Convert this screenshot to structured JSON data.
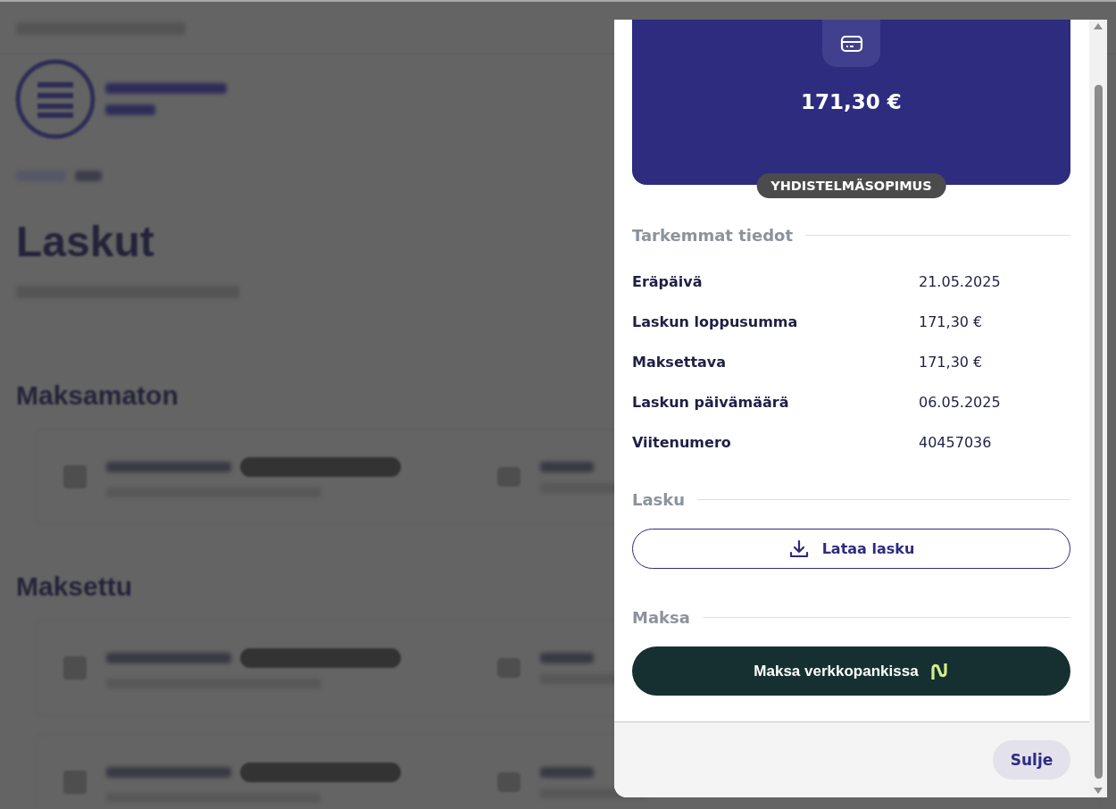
{
  "background_page": {
    "title": "Laskut",
    "sections": [
      {
        "title": "Maksamaton",
        "cards": [
          {
            "kind": "invoice"
          }
        ]
      },
      {
        "title": "Maksettu",
        "cards": [
          {
            "kind": "invoice"
          },
          {
            "kind": "invoice"
          }
        ]
      }
    ]
  },
  "dialog": {
    "amount": "171,30 €",
    "contract_badge": "YHDISTELMÄSOPIMUS",
    "sections": [
      {
        "kind": "details",
        "title": "Tarkemmat tiedot",
        "rows": [
          {
            "label": "Eräpäivä",
            "value": "21.05.2025"
          },
          {
            "label": "Laskun loppusumma",
            "value": "171,30 €"
          },
          {
            "label": "Maksettava",
            "value": "171,30 €"
          },
          {
            "label": "Laskun päivämäärä",
            "value": "06.05.2025"
          },
          {
            "label": "Viitenumero",
            "value": "40457036"
          }
        ]
      },
      {
        "kind": "download",
        "title": "Lasku",
        "button": "Lataa lasku"
      },
      {
        "kind": "pay",
        "title": "Maksa",
        "button": "Maksa verkkopankissa"
      }
    ],
    "close_button": "Sulje"
  }
}
